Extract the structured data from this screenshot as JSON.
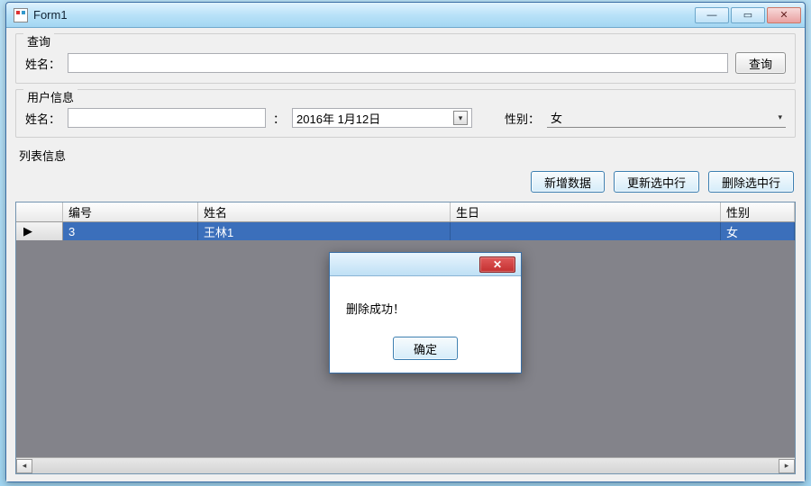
{
  "window": {
    "title": "Form1"
  },
  "query": {
    "legend": "查询",
    "name_label": "姓名：",
    "name_value": "",
    "search_button": "查询"
  },
  "user_info": {
    "legend": "用户信息",
    "name_label": "姓名：",
    "name_value": "",
    "date_label": "：",
    "date_value": "2016年 1月12日",
    "gender_label": "性别：",
    "gender_value": "女"
  },
  "list": {
    "section_label": "列表信息",
    "buttons": {
      "add": "新增数据",
      "update": "更新选中行",
      "delete": "删除选中行"
    },
    "columns": {
      "id": "编号",
      "name": "姓名",
      "birthday": "生日",
      "gender": "性别"
    },
    "rows": [
      {
        "id": "3",
        "name": "王林1",
        "birthday": "",
        "gender": "女"
      }
    ]
  },
  "dialog": {
    "message": "删除成功！",
    "ok": "确定"
  }
}
